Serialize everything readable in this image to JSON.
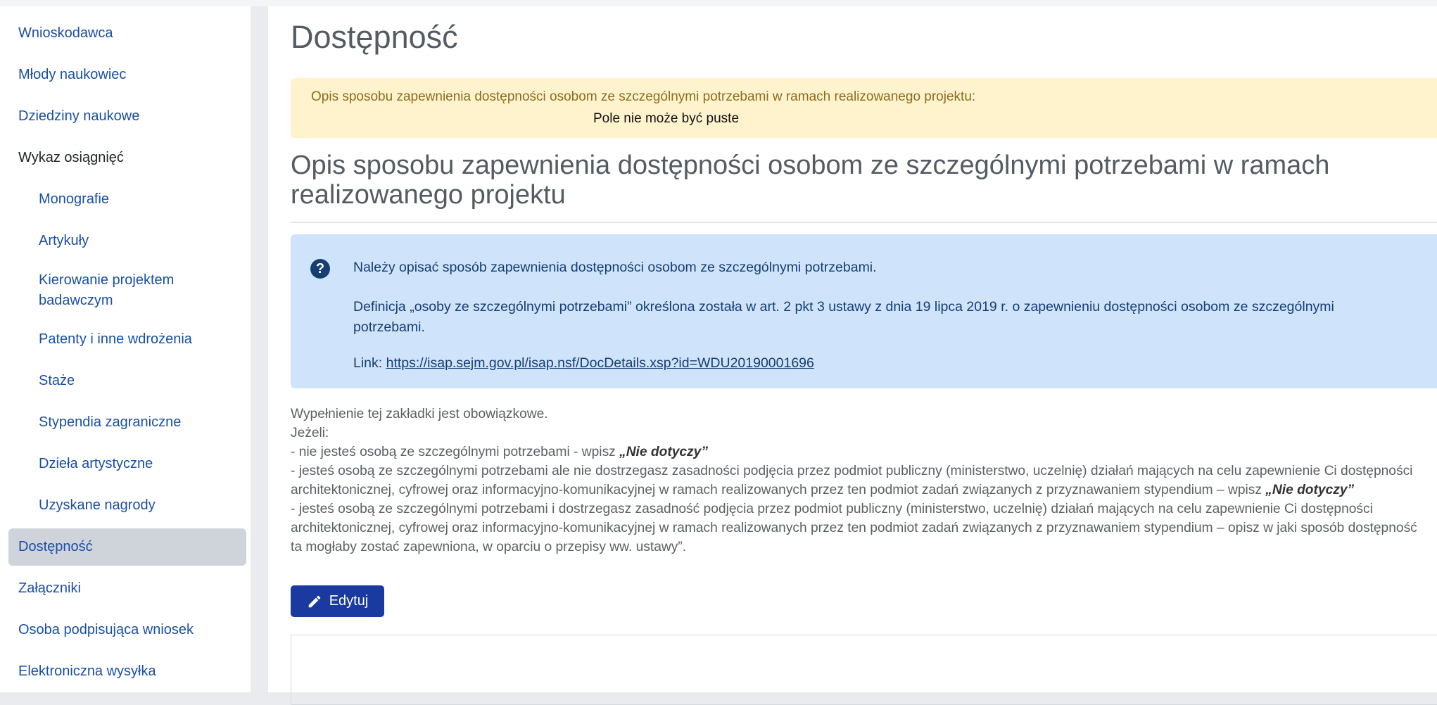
{
  "sidebar": {
    "items": [
      {
        "label": "Wnioskodawca"
      },
      {
        "label": "Młody naukowiec"
      },
      {
        "label": "Dziedziny naukowe"
      },
      {
        "label": "Wykaz osiągnięć"
      },
      {
        "label": "Monografie"
      },
      {
        "label": "Artykuły"
      },
      {
        "label": "Kierowanie projektem badawczym"
      },
      {
        "label": "Patenty i inne wdrożenia"
      },
      {
        "label": "Staże"
      },
      {
        "label": "Stypendia zagraniczne"
      },
      {
        "label": "Dzieła artystyczne"
      },
      {
        "label": "Uzyskane nagrody"
      },
      {
        "label": "Dostępność"
      },
      {
        "label": "Załączniki"
      },
      {
        "label": "Osoba podpisująca wniosek"
      },
      {
        "label": "Elektroniczna wysyłka"
      }
    ],
    "active_label": "Dostępność"
  },
  "main": {
    "title": "Dostępność",
    "warning": {
      "line1": "Opis sposobu zapewnienia dostępności osobom ze szczególnymi potrzebami w ramach realizowanego projektu:",
      "line2": "Pole nie może być puste"
    },
    "section_title": "Opis sposobu zapewnienia dostępności osobom ze szczególnymi potrzebami w ramach realizowanego projektu",
    "info": {
      "icon": "question-circle-icon",
      "p1": "Należy opisać sposób zapewnienia dostępności osobom ze szczególnymi potrzebami.",
      "p2": "Definicja „osoby ze szczególnymi potrzebami” określona została w art. 2 pkt 3 ustawy z dnia 19 lipca 2019 r. o zapewnieniu dostępności osobom ze szczególnymi potrzebami.",
      "link_prefix": "Link: ",
      "link_text": "https://isap.sejm.gov.pl/isap.nsf/DocDetails.xsp?id=WDU20190001696"
    },
    "instructions": {
      "line1": "Wypełnienie tej zakładki jest obowiązkowe.",
      "line2": "Jeżeli:",
      "line3_prefix": "- nie jesteś osobą ze szczególnymi potrzebami - wpisz ",
      "line3_strong": "„Nie dotyczy”",
      "line4_prefix": "- jesteś osobą ze szczególnymi potrzebami ale nie dostrzegasz zasadności podjęcia przez podmiot publiczny (ministerstwo, uczelnię) działań mających na celu zapewnienie Ci dostępności architektonicznej, cyfrowej oraz informacyjno-komunikacyjnej w ramach realizowanych przez ten podmiot zadań związanych z przyznawaniem stypendium – wpisz ",
      "line4_strong": "„Nie dotyczy”",
      "line5": "- jesteś osobą ze szczególnymi potrzebami i dostrzegasz zasadność podjęcia przez podmiot publiczny (ministerstwo, uczelnię) działań mających na celu zapewnienie Ci dostępności architektonicznej, cyfrowej oraz informacyjno-komunikacyjnej w ramach realizowanych przez ten podmiot zadań związanych z przyznawaniem stypendium – opisz w jaki sposób dostępność ta mogłaby zostać zapewniona, w oparciu o przepisy ww. ustawy”."
    },
    "edit_button": {
      "label": "Edytuj",
      "icon": "pencil-icon"
    }
  },
  "colors": {
    "link": "#1a4fa6",
    "active_bg": "#cfd3da",
    "warning_bg": "#fff3cd",
    "info_bg": "#cfe3fb",
    "button_bg": "#1a3aa0"
  }
}
